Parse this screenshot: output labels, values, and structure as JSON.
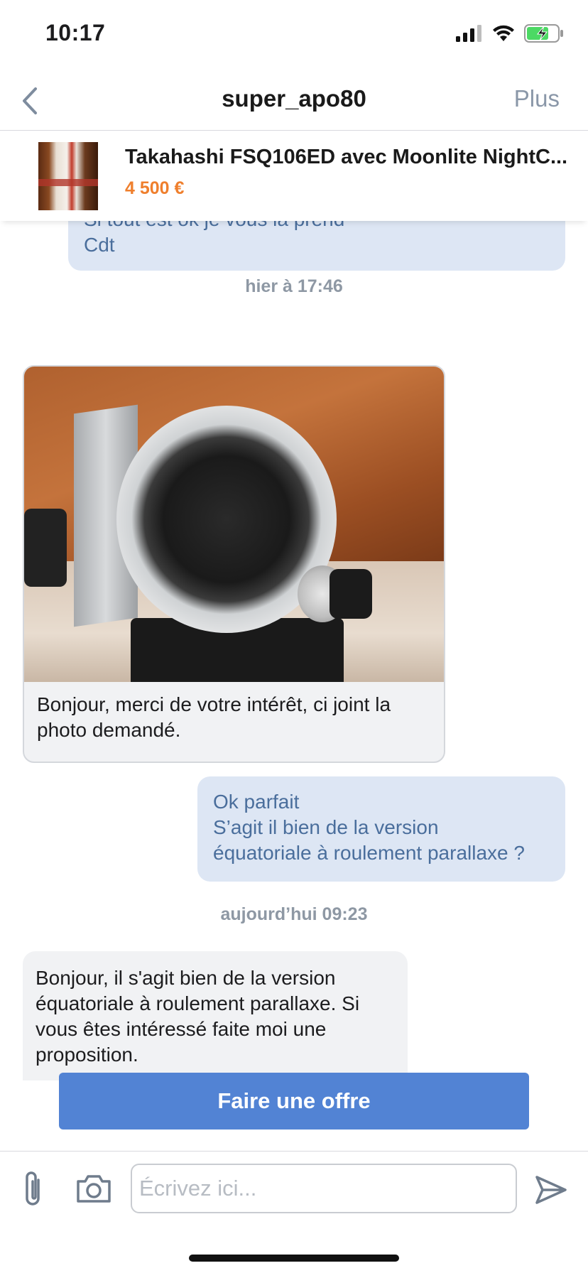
{
  "status_bar": {
    "time": "10:17"
  },
  "nav": {
    "title": "super_apo80",
    "more_label": "Plus"
  },
  "product": {
    "title": "Takahashi FSQ106ED avec Moonlite NightC...",
    "price": "4 500 €"
  },
  "messages": {
    "first_out": {
      "line1": "Si tout est ok je vous la prend",
      "line2": "Cdt"
    },
    "timestamp_1": "hier à 17:46",
    "photo_caption": "Bonjour, merci de votre intérêt, ci joint la photo demandé.",
    "second_out": {
      "line1": "Ok parfait",
      "line2": "S’agit il bien de la version",
      "line3": "équatoriale à roulement parallaxe ?"
    },
    "timestamp_2": "aujourd’hui 09:23",
    "last_in": "Bonjour, il s'agit bien de la version équatoriale à roulement parallaxe. Si vous êtes intéressé faite moi une proposition."
  },
  "offer_button": {
    "label": "Faire une offre"
  },
  "composer": {
    "placeholder": "Écrivez ici..."
  },
  "colors": {
    "accent": "#5283d4",
    "price": "#ef7f2d",
    "outgoing_bubble": "#dde6f4",
    "outgoing_text": "#4a6e9c",
    "incoming_bubble": "#f1f2f4",
    "battery": "#4cd964"
  },
  "icons": {
    "back": "chevron-left-icon",
    "signal": "cellular-signal-icon",
    "wifi": "wifi-icon",
    "battery": "battery-charging-icon",
    "attach": "paperclip-icon",
    "camera": "camera-icon",
    "send": "send-icon"
  }
}
